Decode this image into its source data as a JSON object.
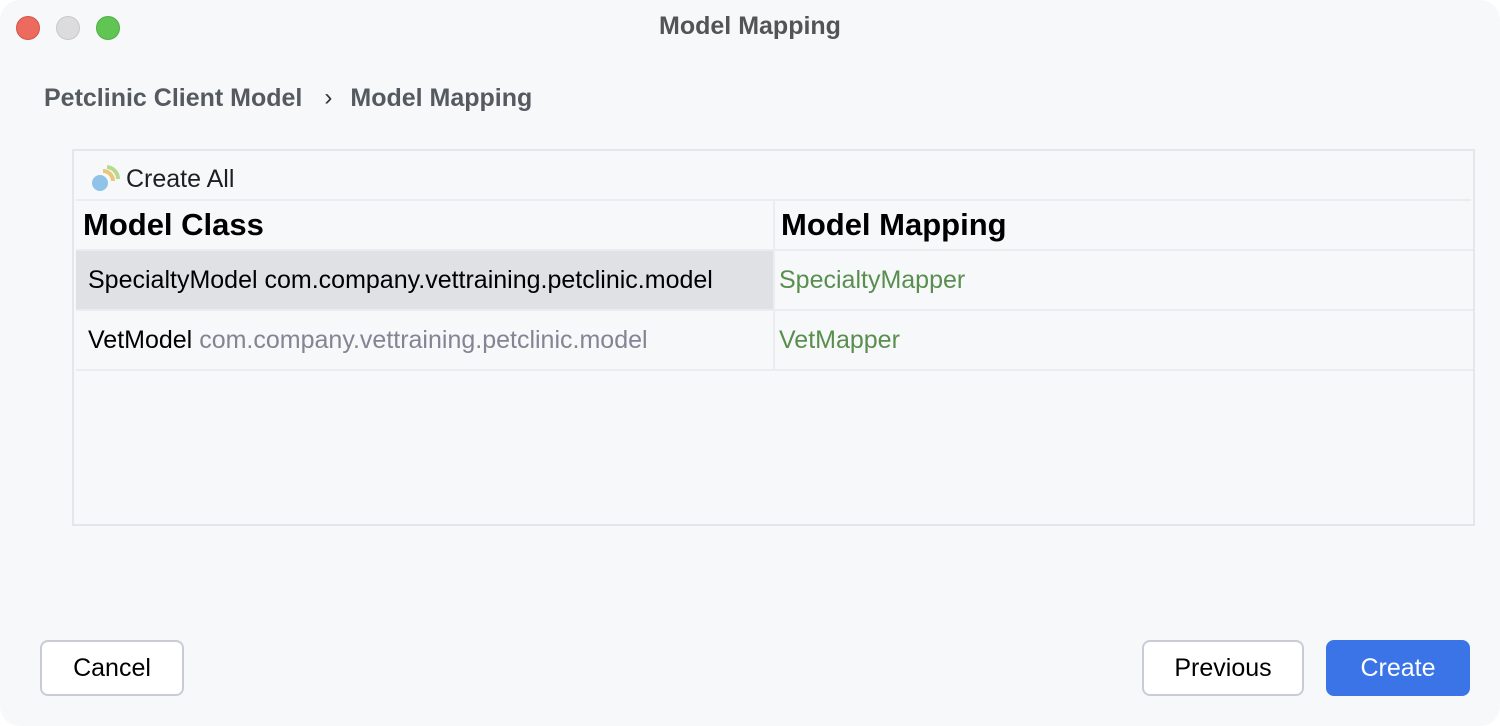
{
  "window": {
    "title": "Model Mapping"
  },
  "breadcrumb": {
    "items": [
      "Petclinic Client Model",
      "Model Mapping"
    ],
    "separator": "›"
  },
  "toolbar": {
    "create_all_label": "Create All",
    "icon": "create-all-icon"
  },
  "table": {
    "columns": [
      "Model Class",
      "Model Mapping"
    ],
    "rows": [
      {
        "class_name": "SpecialtyModel",
        "package": "com.company.vettraining.petclinic.model",
        "mapping": "SpecialtyMapper",
        "selected": true
      },
      {
        "class_name": "VetModel",
        "package": "com.company.vettraining.petclinic.model",
        "mapping": "VetMapper",
        "selected": false
      }
    ]
  },
  "buttons": {
    "cancel": "Cancel",
    "previous": "Previous",
    "create": "Create"
  },
  "colors": {
    "accent": "#3a74e7",
    "mapping_text": "#5a8e4f",
    "package_text": "#818594",
    "selection": "#dfe1e5"
  }
}
